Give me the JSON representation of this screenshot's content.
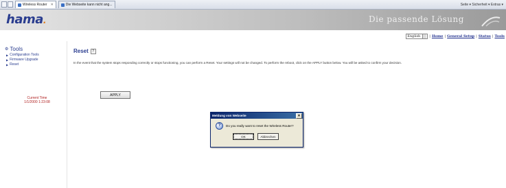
{
  "browser": {
    "tabs": [
      {
        "label": "Wireless Router"
      },
      {
        "label": "Die Webseite kann nicht ang..."
      }
    ],
    "toolbar_text": "Seite ▾  Sicherheit ▾  Extras ▾"
  },
  "header": {
    "logo": "hama",
    "slogan": "Die passende Lösung"
  },
  "topnav": {
    "language": "English",
    "links": [
      "Home",
      "General Setup",
      "Status",
      "Tools"
    ]
  },
  "sidebar": {
    "title": "Tools",
    "items": [
      {
        "label": "Configuration Tools"
      },
      {
        "label": "Firmware Upgrade"
      },
      {
        "label": "Reset"
      }
    ],
    "current_time_label": "Current Time",
    "current_time_value": "1/1/2000 1:23:08"
  },
  "main": {
    "title": "Reset",
    "description": "In the event that the system stops responding correctly or stops functioning, you can perform a Reset. Your settings will not be changed. To perform the reboot, click on the APPLY button below. You will be asked to confirm your decision.",
    "apply_label": "APPLY"
  },
  "dialog": {
    "title": "Meldung von Webseite",
    "message": "Do you really want to reset the Wireless Router?",
    "ok_label": "OK",
    "cancel_label": "Abbrechen"
  }
}
